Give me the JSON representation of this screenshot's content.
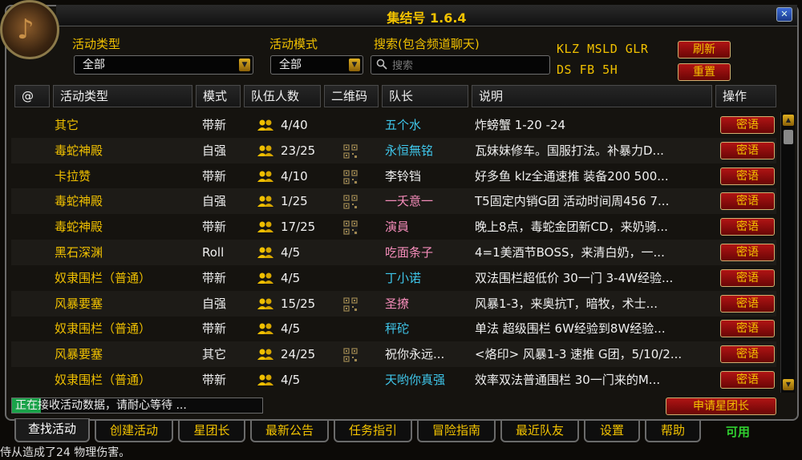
{
  "window": {
    "title": "集结号 1.6.4"
  },
  "filters": {
    "activity_type_label": "活动类型",
    "activity_type_value": "全部",
    "mode_label": "活动模式",
    "mode_value": "全部",
    "search_label": "搜索(包含频道聊天)",
    "search_placeholder": "搜索"
  },
  "addon_status": {
    "line1": "KLZ MSLD GLR",
    "line2": "DS FB 5H"
  },
  "buttons": {
    "refresh": "刷新",
    "reset": "重置",
    "apply_leader": "申请星团长",
    "whisper": "密语"
  },
  "columns": [
    "@",
    "活动类型",
    "模式",
    "队伍人数",
    "二维码",
    "队长",
    "说明",
    "操作"
  ],
  "rows": [
    {
      "type": "其它",
      "mode": "带新",
      "size": "4/40",
      "qr": false,
      "leader": "五个水",
      "leader_color": "#3fc7eb",
      "desc": "炸螃蟹 1-20 -24"
    },
    {
      "type": "毒蛇神殿",
      "mode": "自强",
      "size": "23/25",
      "qr": true,
      "leader": "永恒無铭",
      "leader_color": "#3fc7eb",
      "desc": "瓦妹妹修车。国服打法。补暴力D..."
    },
    {
      "type": "卡拉赞",
      "mode": "带新",
      "size": "4/10",
      "qr": true,
      "leader": "李铃铛",
      "leader_color": "#f0f0f0",
      "desc": "好多鱼 klz全通速推 装备200 500..."
    },
    {
      "type": "毒蛇神殿",
      "mode": "自强",
      "size": "1/25",
      "qr": true,
      "leader": "一夭意一",
      "leader_color": "#f58cba",
      "desc": "T5固定内销G团 活动时间周456 7..."
    },
    {
      "type": "毒蛇神殿",
      "mode": "带新",
      "size": "17/25",
      "qr": true,
      "leader": "演員",
      "leader_color": "#f58cba",
      "desc": "晚上8点，毒蛇金团新CD，来奶骑..."
    },
    {
      "type": "黑石深渊",
      "mode": "Roll",
      "size": "4/5",
      "qr": false,
      "leader": "吃面条子",
      "leader_color": "#f58cba",
      "desc": "4=1美酒节BOSS，来清白奶，一..."
    },
    {
      "type": "奴隶围栏（普通）",
      "mode": "带新",
      "size": "4/5",
      "qr": false,
      "leader": "丁小诺",
      "leader_color": "#3fc7eb",
      "desc": "双法围栏超低价 30一门 3-4W经验..."
    },
    {
      "type": "风暴要塞",
      "mode": "自强",
      "size": "15/25",
      "qr": true,
      "leader": "圣撩",
      "leader_color": "#f58cba",
      "desc": "风暴1-3，来奥抗T，暗牧，术士..."
    },
    {
      "type": "奴隶围栏（普通）",
      "mode": "带新",
      "size": "4/5",
      "qr": false,
      "leader": "秤砣",
      "leader_color": "#3fc7eb",
      "desc": "单法 超级围栏 6W经验到8W经验..."
    },
    {
      "type": "风暴要塞",
      "mode": "其它",
      "size": "24/25",
      "qr": true,
      "leader": "祝你永远...",
      "leader_color": "#f0f0f0",
      "desc": "<烙印> 风暴1-3 速推 G团，5/10/2..."
    },
    {
      "type": "奴隶围栏（普通）",
      "mode": "带新",
      "size": "4/5",
      "qr": false,
      "leader": "天哟你真强",
      "leader_color": "#3fc7eb",
      "desc": "效率双法普通围栏 30一门来的M..."
    }
  ],
  "status": {
    "text": "正在接收活动数据，请耐心等待 ..."
  },
  "tabs": [
    "查找活动",
    "创建活动",
    "星团长",
    "最新公告",
    "任务指引",
    "冒险指南",
    "最近队友",
    "设置",
    "帮助"
  ],
  "available_label": "可用",
  "chat_line": "侍从造成了24 物理伤害。",
  "colors": {
    "accent_gold": "#f0c000",
    "button_red": "#b01414",
    "mage_blue": "#3fc7eb",
    "paladin_pink": "#f58cba"
  },
  "icons": {
    "close": "close-icon",
    "people": "group-icon",
    "qr": "qr-code-icon",
    "search": "search-icon"
  }
}
